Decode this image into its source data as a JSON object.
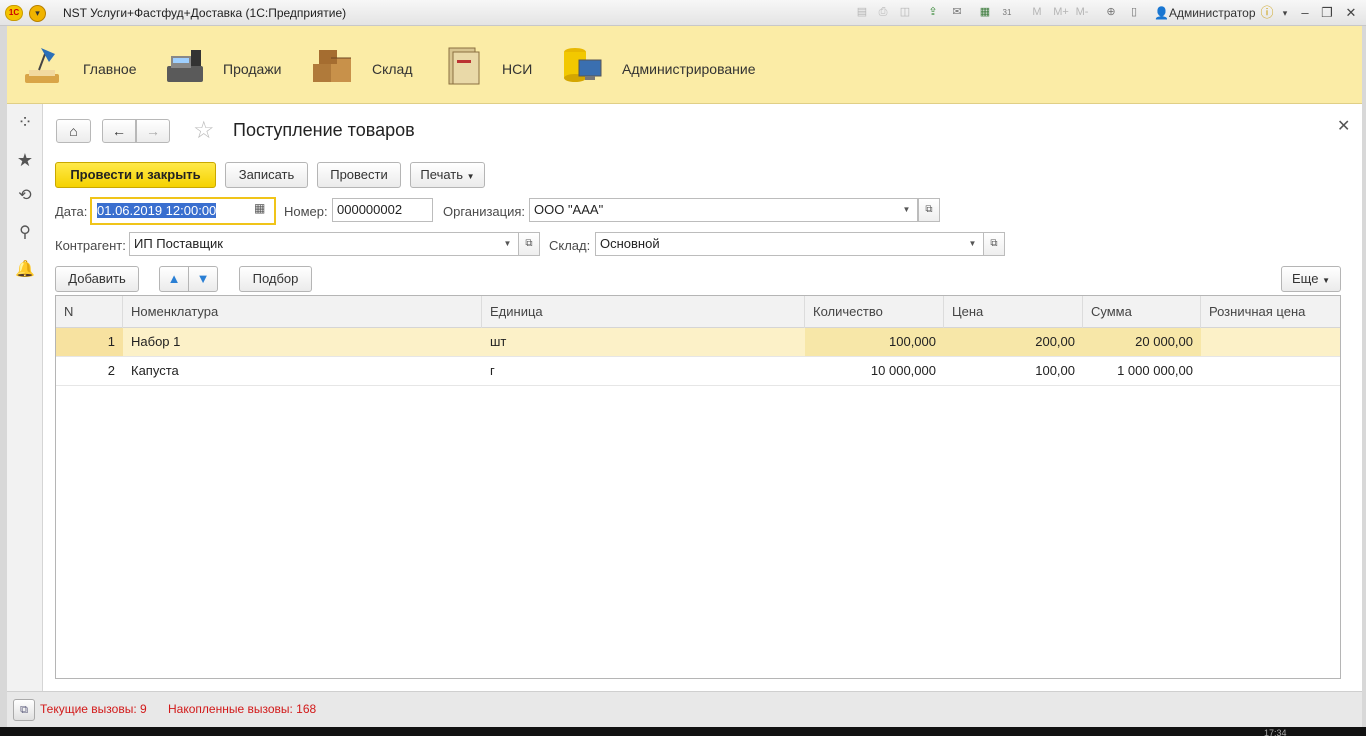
{
  "window": {
    "title": "NST Услуги+Фастфуд+Доставка  (1С:Предприятие)",
    "logo_text": "1С",
    "user": "Администратор",
    "toolbar_icons": [
      "save-icon",
      "print-icon",
      "preview-icon",
      "upload-icon",
      "mail-icon",
      "calculator-icon",
      "calendar-icon",
      "m-icon",
      "m-plus-icon",
      "m-minus-icon",
      "zoom-icon",
      "panels-icon"
    ],
    "memory_labels": {
      "m": "M",
      "mplus": "M+",
      "mminus": "M-"
    },
    "calendar_day": "31"
  },
  "sections": [
    {
      "label": "Главное",
      "icon": "lamp-icon"
    },
    {
      "label": "Продажи",
      "icon": "cash-register-icon"
    },
    {
      "label": "Склад",
      "icon": "boxes-icon"
    },
    {
      "label": "НСИ",
      "icon": "folder-icon"
    },
    {
      "label": "Администрирование",
      "icon": "database-monitor-icon"
    }
  ],
  "document": {
    "title": "Поступление товаров",
    "buttons": {
      "post_close": "Провести и закрыть",
      "save": "Записать",
      "post": "Провести",
      "print": "Печать"
    },
    "fields": {
      "date_label": "Дата:",
      "date_value": "01.06.2019 12:00:00",
      "number_label": "Номер:",
      "number_value": "000000002",
      "org_label": "Организация:",
      "org_value": "ООО \"ААА\"",
      "contractor_label": "Контрагент:",
      "contractor_value": "ИП Поставщик",
      "warehouse_label": "Склад:",
      "warehouse_value": "Основной"
    },
    "table_buttons": {
      "add": "Добавить",
      "pick": "Подбор",
      "more": "Еще"
    },
    "table": {
      "columns": [
        "N",
        "Номенклатура",
        "Единица",
        "Количество",
        "Цена",
        "Сумма",
        "Розничная цена"
      ],
      "rows": [
        {
          "n": "1",
          "item": "Набор 1",
          "unit": "шт",
          "qty": "100,000",
          "price": "200,00",
          "sum": "20 000,00",
          "retail": ""
        },
        {
          "n": "2",
          "item": "Капуста",
          "unit": "г",
          "qty": "10 000,000",
          "price": "100,00",
          "sum": "1 000 000,00",
          "retail": ""
        }
      ]
    }
  },
  "status": {
    "current_calls": "Текущие вызовы: 9",
    "accumulated_calls": "Накопленные вызовы: 168"
  },
  "clock": "17:34"
}
